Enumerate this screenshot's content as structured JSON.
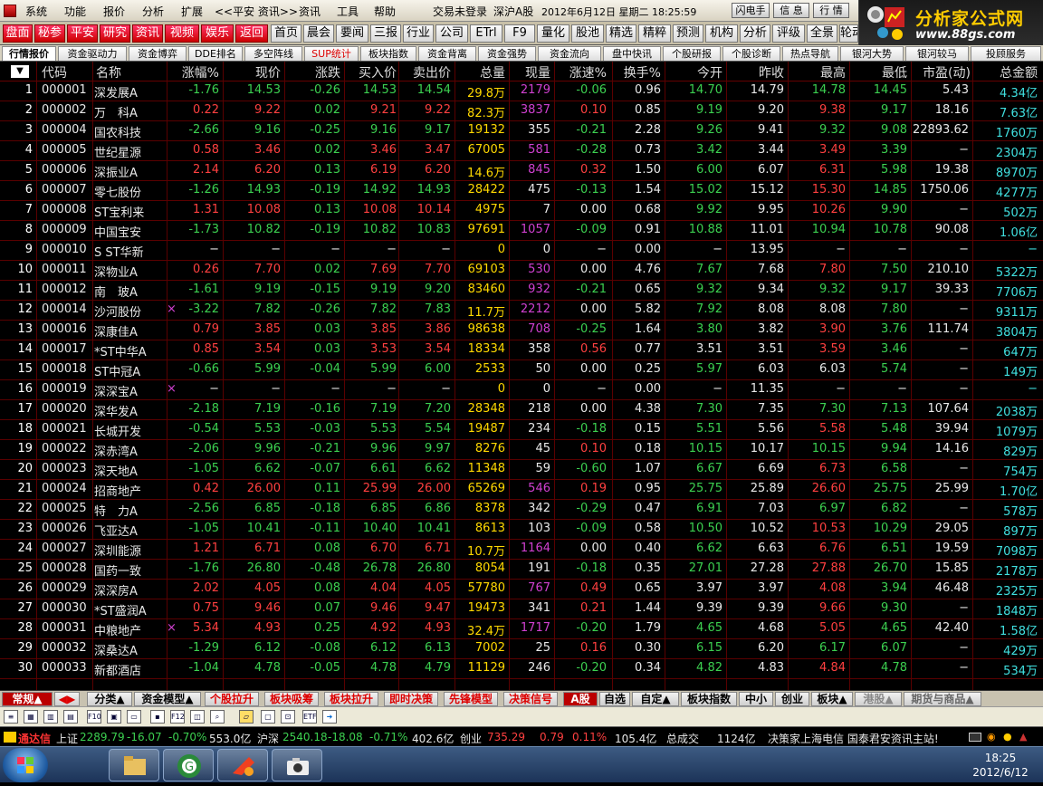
{
  "menu": {
    "items": [
      "系统",
      "功能",
      "报价",
      "分析",
      "扩展",
      "<<平安 资讯>>",
      "资讯",
      "工具",
      "帮助"
    ],
    "status": "交易未登录",
    "market": "深沪A股",
    "datetime": "2012年6月12日 星期二 18:25:59",
    "right_buttons": [
      "闪电手",
      "信 息",
      "行 情"
    ]
  },
  "logo": {
    "title": "分析家公式网",
    "url": "www.88gs.com"
  },
  "toolbar": [
    "盘面",
    "秘参",
    "平安",
    "研究",
    "资讯",
    "视频",
    "娱乐",
    "返回",
    "首页",
    "晨会",
    "要闻",
    "三报",
    "行业",
    "公司",
    "ETrl",
    "F9",
    "量化",
    "股池",
    "精选",
    "精粹",
    "预测",
    "机构",
    "分析",
    "评级",
    "全景",
    "轮动"
  ],
  "tabs": [
    "行情报价",
    "资金驱动力",
    "资金博弈",
    "DDE排名",
    "多空阵线",
    "SUP统计",
    "板块指数",
    "资金背离",
    "资金强势",
    "资金流向",
    "盘中快讯",
    "个股研报",
    "个股诊断",
    "热点导航",
    "银河大势",
    "银河较马",
    "投顾服务"
  ],
  "columns": [
    "代码",
    "名称",
    "涨幅%",
    "现价",
    "涨跌",
    "买入价",
    "卖出价",
    "总量",
    "现量",
    "涨速%",
    "换手%",
    "今开",
    "昨收",
    "最高",
    "最低",
    "市盈(动)",
    "总金额"
  ],
  "rows": [
    [
      "1",
      "000001",
      "深发展A",
      "",
      "-1.76",
      "14.53",
      "-0.26",
      "14.53",
      "14.54",
      "29.8万",
      "2179",
      "-0.06",
      "0.96",
      "14.70",
      "14.79",
      "14.78",
      "14.45",
      "5.43",
      "4.34亿"
    ],
    [
      "2",
      "000002",
      "万　科A",
      "",
      "0.22",
      "9.22",
      "0.02",
      "9.21",
      "9.22",
      "82.3万",
      "3837",
      "0.10",
      "0.85",
      "9.19",
      "9.20",
      "9.38",
      "9.17",
      "18.16",
      "7.63亿"
    ],
    [
      "3",
      "000004",
      "国农科技",
      "",
      "-2.66",
      "9.16",
      "-0.25",
      "9.16",
      "9.17",
      "19132",
      "355",
      "-0.21",
      "2.28",
      "9.26",
      "9.41",
      "9.32",
      "9.08",
      "22893.62",
      "1760万"
    ],
    [
      "4",
      "000005",
      "世纪星源",
      "",
      "0.58",
      "3.46",
      "0.02",
      "3.46",
      "3.47",
      "67005",
      "581",
      "-0.28",
      "0.73",
      "3.42",
      "3.44",
      "3.49",
      "3.39",
      "−",
      "2304万"
    ],
    [
      "5",
      "000006",
      "深振业A",
      "",
      "2.14",
      "6.20",
      "0.13",
      "6.19",
      "6.20",
      "14.6万",
      "845",
      "0.32",
      "1.50",
      "6.00",
      "6.07",
      "6.31",
      "5.98",
      "19.38",
      "8970万"
    ],
    [
      "6",
      "000007",
      "零七股份",
      "",
      "-1.26",
      "14.93",
      "-0.19",
      "14.92",
      "14.93",
      "28422",
      "475",
      "-0.13",
      "1.54",
      "15.02",
      "15.12",
      "15.30",
      "14.85",
      "1750.06",
      "4277万"
    ],
    [
      "7",
      "000008",
      "ST宝利来",
      "",
      "1.31",
      "10.08",
      "0.13",
      "10.08",
      "10.14",
      "4975",
      "7",
      "0.00",
      "0.68",
      "9.92",
      "9.95",
      "10.26",
      "9.90",
      "−",
      "502万"
    ],
    [
      "8",
      "000009",
      "中国宝安",
      "",
      "-1.73",
      "10.82",
      "-0.19",
      "10.82",
      "10.83",
      "97691",
      "1057",
      "-0.09",
      "0.91",
      "10.88",
      "11.01",
      "10.94",
      "10.78",
      "90.08",
      "1.06亿"
    ],
    [
      "9",
      "000010",
      "S ST华新",
      "",
      "−",
      "−",
      "−",
      "−",
      "−",
      "0",
      "0",
      "−",
      "0.00",
      "−",
      "13.95",
      "−",
      "−",
      "−",
      "−"
    ],
    [
      "10",
      "000011",
      "深物业A",
      "",
      "0.26",
      "7.70",
      "0.02",
      "7.69",
      "7.70",
      "69103",
      "530",
      "0.00",
      "4.76",
      "7.67",
      "7.68",
      "7.80",
      "7.50",
      "210.10",
      "5322万"
    ],
    [
      "11",
      "000012",
      "南　玻A",
      "",
      "-1.61",
      "9.19",
      "-0.15",
      "9.19",
      "9.20",
      "83460",
      "932",
      "-0.21",
      "0.65",
      "9.32",
      "9.34",
      "9.32",
      "9.17",
      "39.33",
      "7706万"
    ],
    [
      "12",
      "000014",
      "沙河股份",
      "×",
      "-3.22",
      "7.82",
      "-0.26",
      "7.82",
      "7.83",
      "11.7万",
      "2212",
      "0.00",
      "5.82",
      "7.92",
      "8.08",
      "8.08",
      "7.80",
      "−",
      "9311万"
    ],
    [
      "13",
      "000016",
      "深康佳A",
      "",
      "0.79",
      "3.85",
      "0.03",
      "3.85",
      "3.86",
      "98638",
      "708",
      "-0.25",
      "1.64",
      "3.80",
      "3.82",
      "3.90",
      "3.76",
      "111.74",
      "3804万"
    ],
    [
      "14",
      "000017",
      "*ST中华A",
      "",
      "0.85",
      "3.54",
      "0.03",
      "3.53",
      "3.54",
      "18334",
      "358",
      "0.56",
      "0.77",
      "3.51",
      "3.51",
      "3.59",
      "3.46",
      "−",
      "647万"
    ],
    [
      "15",
      "000018",
      "ST中冠A",
      "",
      "-0.66",
      "5.99",
      "-0.04",
      "5.99",
      "6.00",
      "2533",
      "50",
      "0.00",
      "0.25",
      "5.97",
      "6.03",
      "6.03",
      "5.74",
      "−",
      "149万"
    ],
    [
      "16",
      "000019",
      "深深宝A",
      "×",
      "−",
      "−",
      "−",
      "−",
      "−",
      "0",
      "0",
      "−",
      "0.00",
      "−",
      "11.35",
      "−",
      "−",
      "−",
      "−"
    ],
    [
      "17",
      "000020",
      "深华发A",
      "",
      "-2.18",
      "7.19",
      "-0.16",
      "7.19",
      "7.20",
      "28348",
      "218",
      "0.00",
      "4.38",
      "7.30",
      "7.35",
      "7.30",
      "7.13",
      "107.64",
      "2038万"
    ],
    [
      "18",
      "000021",
      "长城开发",
      "",
      "-0.54",
      "5.53",
      "-0.03",
      "5.53",
      "5.54",
      "19487",
      "234",
      "-0.18",
      "0.15",
      "5.51",
      "5.56",
      "5.58",
      "5.48",
      "39.94",
      "1079万"
    ],
    [
      "19",
      "000022",
      "深赤湾A",
      "",
      "-2.06",
      "9.96",
      "-0.21",
      "9.96",
      "9.97",
      "8276",
      "45",
      "0.10",
      "0.18",
      "10.15",
      "10.17",
      "10.15",
      "9.94",
      "14.16",
      "829万"
    ],
    [
      "20",
      "000023",
      "深天地A",
      "",
      "-1.05",
      "6.62",
      "-0.07",
      "6.61",
      "6.62",
      "11348",
      "59",
      "-0.60",
      "1.07",
      "6.67",
      "6.69",
      "6.73",
      "6.58",
      "−",
      "754万"
    ],
    [
      "21",
      "000024",
      "招商地产",
      "",
      "0.42",
      "26.00",
      "0.11",
      "25.99",
      "26.00",
      "65269",
      "546",
      "0.19",
      "0.95",
      "25.75",
      "25.89",
      "26.60",
      "25.75",
      "25.99",
      "1.70亿"
    ],
    [
      "22",
      "000025",
      "特　力A",
      "",
      "-2.56",
      "6.85",
      "-0.18",
      "6.85",
      "6.86",
      "8378",
      "342",
      "-0.29",
      "0.47",
      "6.91",
      "7.03",
      "6.97",
      "6.82",
      "−",
      "578万"
    ],
    [
      "23",
      "000026",
      "飞亚达A",
      "",
      "-1.05",
      "10.41",
      "-0.11",
      "10.40",
      "10.41",
      "8613",
      "103",
      "-0.09",
      "0.58",
      "10.50",
      "10.52",
      "10.53",
      "10.29",
      "29.05",
      "897万"
    ],
    [
      "24",
      "000027",
      "深圳能源",
      "",
      "1.21",
      "6.71",
      "0.08",
      "6.70",
      "6.71",
      "10.7万",
      "1164",
      "0.00",
      "0.40",
      "6.62",
      "6.63",
      "6.76",
      "6.51",
      "19.59",
      "7098万"
    ],
    [
      "25",
      "000028",
      "国药一致",
      "",
      "-1.76",
      "26.80",
      "-0.48",
      "26.78",
      "26.80",
      "8054",
      "191",
      "-0.18",
      "0.35",
      "27.01",
      "27.28",
      "27.88",
      "26.70",
      "15.85",
      "2178万"
    ],
    [
      "26",
      "000029",
      "深深房A",
      "",
      "2.02",
      "4.05",
      "0.08",
      "4.04",
      "4.05",
      "57780",
      "767",
      "0.49",
      "0.65",
      "3.97",
      "3.97",
      "4.08",
      "3.94",
      "46.48",
      "2325万"
    ],
    [
      "27",
      "000030",
      "*ST盛润A",
      "",
      "0.75",
      "9.46",
      "0.07",
      "9.46",
      "9.47",
      "19473",
      "341",
      "0.21",
      "1.44",
      "9.39",
      "9.39",
      "9.66",
      "9.30",
      "−",
      "1848万"
    ],
    [
      "28",
      "000031",
      "中粮地产",
      "×",
      "5.34",
      "4.93",
      "0.25",
      "4.92",
      "4.93",
      "32.4万",
      "1717",
      "-0.20",
      "1.79",
      "4.65",
      "4.68",
      "5.05",
      "4.65",
      "42.40",
      "1.58亿"
    ],
    [
      "29",
      "000032",
      "深桑达A",
      "",
      "-1.29",
      "6.12",
      "-0.08",
      "6.12",
      "6.13",
      "7002",
      "25",
      "0.16",
      "0.30",
      "6.15",
      "6.20",
      "6.17",
      "6.07",
      "−",
      "429万"
    ],
    [
      "30",
      "000033",
      "新都酒店",
      "",
      "-1.04",
      "4.78",
      "-0.05",
      "4.78",
      "4.79",
      "11129",
      "246",
      "-0.20",
      "0.34",
      "4.82",
      "4.83",
      "4.84",
      "4.78",
      "−",
      "534万"
    ]
  ],
  "bottom_tabs": [
    "常规▲",
    "◀▶",
    "分类▲",
    "资金模型▲",
    "个股拉升",
    "板块吸筹",
    "板块拉升",
    "即时决策",
    "先锋模型",
    "决策信号",
    "A股",
    "自选",
    "自定▲",
    "板块指数",
    "中小",
    "创业",
    "板块▲",
    "港股▲",
    "期货与商品▲"
  ],
  "icon_tools": [
    "list-icon",
    "grid-icon",
    "chart-icon",
    "kline-icon",
    "f10-icon",
    "report-icon",
    "doc-icon",
    "f12-icon",
    "filter-icon",
    "zoom-icon",
    "folder-icon",
    "window-icon",
    "select-icon",
    "fit-icon",
    "etf-icon",
    "arrow-icon"
  ],
  "status": {
    "brand": "通达信",
    "sh_label": "上证",
    "sh_val": "2289.79",
    "sh_chg": "-16.07",
    "sh_pct": "-0.70%",
    "sh_amt": "553.0亿",
    "sz_label": "沪深",
    "sz_val": "2540.18",
    "sz_chg": "-18.08",
    "sz_pct": "-0.71%",
    "sz_amt": "402.6亿",
    "cy_label": "创业",
    "cy_val": "735.29",
    "cy_chg": "0.79",
    "cy_pct": "0.11%",
    "cy_amt": "105.4亿",
    "turn_label": "总成交",
    "turn_val": "1124亿",
    "ticker": "决策家上海电信 国泰君安资讯主站!"
  },
  "taskbar": {
    "time": "18:25",
    "date": "2012/6/12"
  }
}
